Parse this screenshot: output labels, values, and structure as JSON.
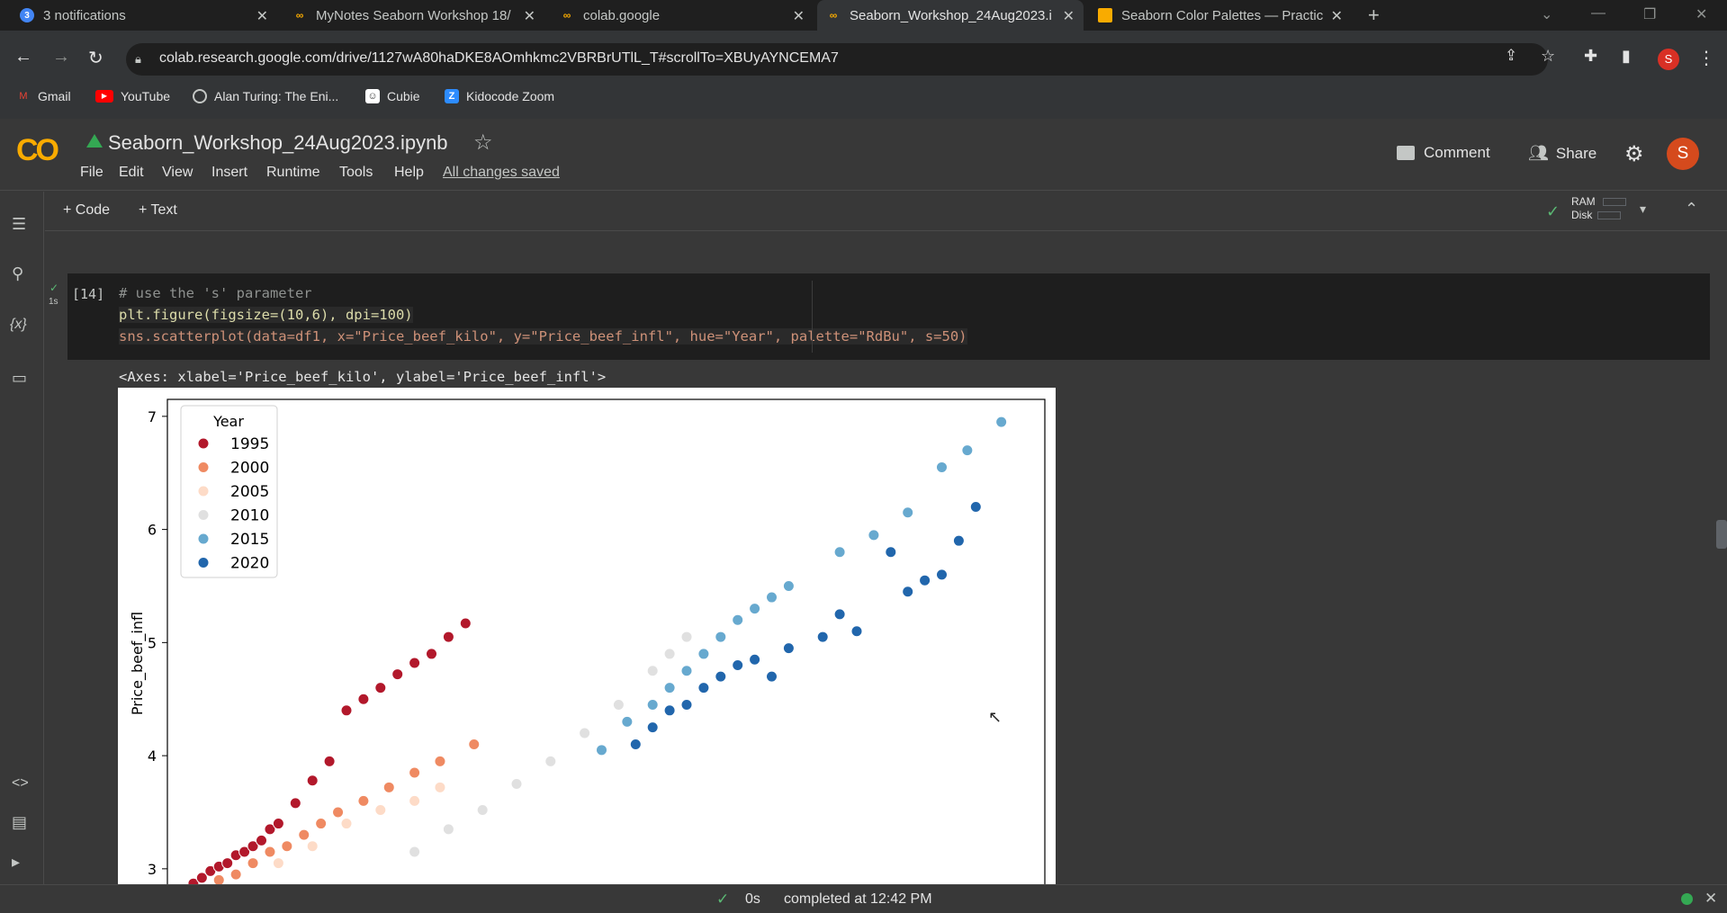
{
  "browser": {
    "tabs": [
      {
        "title": "3 notifications",
        "badge": "3"
      },
      {
        "title": "MyNotes Seaborn Workshop 18/"
      },
      {
        "title": "colab.google"
      },
      {
        "title": "Seaborn_Workshop_24Aug2023.i"
      },
      {
        "title": "Seaborn Color Palettes — Practic"
      }
    ],
    "new_tab": "+",
    "url": "colab.research.google.com/drive/1127wA80haDKE8AOmhkmc2VBRBrUTlL_T#scrollTo=XBUyAYNCEMA7",
    "profile_initial": "S",
    "bookmarks": [
      {
        "label": "Gmail"
      },
      {
        "label": "YouTube"
      },
      {
        "label": "Alan Turing: The Eni..."
      },
      {
        "label": "Cubie"
      },
      {
        "label": "Kidocode Zoom"
      }
    ]
  },
  "colab": {
    "logo": "CO",
    "notebook_title": "Seaborn_Workshop_24Aug2023.ipynb",
    "menu": [
      "File",
      "Edit",
      "View",
      "Insert",
      "Runtime",
      "Tools",
      "Help"
    ],
    "save_status": "All changes saved",
    "comment_label": "Comment",
    "share_label": "Share",
    "avatar_initial": "S",
    "add_code": "+ Code",
    "add_text": "+ Text",
    "ram_label": "RAM",
    "disk_label": "Disk"
  },
  "cell": {
    "exec_count": "[14]",
    "exec_time": "1s",
    "line1": "# use the 's' parameter",
    "line2": "plt.figure(figsize=(10,6), dpi=100)",
    "line3": "sns.scatterplot(data=df1, x=\"Price_beef_kilo\", y=\"Price_beef_infl\", hue=\"Year\", palette=\"RdBu\", s=50)",
    "output_text": "<Axes: xlabel='Price_beef_kilo', ylabel='Price_beef_infl'>"
  },
  "chart_data": {
    "type": "scatter",
    "ylabel": "Price_beef_infl",
    "xlabel": "",
    "yticks": [
      3,
      4,
      5,
      6,
      7
    ],
    "ylim": [
      2.8,
      7.15
    ],
    "xlim": [
      0,
      1
    ],
    "legend_title": "Year",
    "legend_position": "top-left",
    "series": [
      {
        "name": "1995",
        "color": "#b2182b",
        "points": [
          [
            0.02,
            2.87
          ],
          [
            0.03,
            2.92
          ],
          [
            0.04,
            2.98
          ],
          [
            0.05,
            3.02
          ],
          [
            0.06,
            3.05
          ],
          [
            0.07,
            3.12
          ],
          [
            0.08,
            3.15
          ],
          [
            0.09,
            3.2
          ],
          [
            0.1,
            3.25
          ],
          [
            0.11,
            3.35
          ],
          [
            0.12,
            3.4
          ],
          [
            0.14,
            3.58
          ],
          [
            0.16,
            3.78
          ],
          [
            0.18,
            3.95
          ],
          [
            0.2,
            4.4
          ],
          [
            0.22,
            4.5
          ],
          [
            0.24,
            4.6
          ],
          [
            0.26,
            4.72
          ],
          [
            0.28,
            4.82
          ],
          [
            0.3,
            4.9
          ],
          [
            0.32,
            5.05
          ],
          [
            0.34,
            5.17
          ]
        ]
      },
      {
        "name": "2000",
        "color": "#ef8a62",
        "points": [
          [
            0.05,
            2.9
          ],
          [
            0.07,
            2.95
          ],
          [
            0.09,
            3.05
          ],
          [
            0.11,
            3.15
          ],
          [
            0.13,
            3.2
          ],
          [
            0.15,
            3.3
          ],
          [
            0.17,
            3.4
          ],
          [
            0.19,
            3.5
          ],
          [
            0.22,
            3.6
          ],
          [
            0.25,
            3.72
          ],
          [
            0.28,
            3.85
          ],
          [
            0.31,
            3.95
          ],
          [
            0.35,
            4.1
          ]
        ]
      },
      {
        "name": "2005",
        "color": "#fddbc7",
        "points": [
          [
            0.12,
            3.05
          ],
          [
            0.16,
            3.2
          ],
          [
            0.2,
            3.4
          ],
          [
            0.24,
            3.52
          ],
          [
            0.28,
            3.6
          ],
          [
            0.31,
            3.72
          ]
        ]
      },
      {
        "name": "2010",
        "color": "#e0e0e0",
        "points": [
          [
            0.28,
            3.15
          ],
          [
            0.32,
            3.35
          ],
          [
            0.36,
            3.52
          ],
          [
            0.4,
            3.75
          ],
          [
            0.44,
            3.95
          ],
          [
            0.48,
            4.2
          ],
          [
            0.52,
            4.45
          ],
          [
            0.56,
            4.75
          ],
          [
            0.58,
            4.9
          ],
          [
            0.6,
            5.05
          ]
        ]
      },
      {
        "name": "2015",
        "color": "#67a9cf",
        "points": [
          [
            0.5,
            4.05
          ],
          [
            0.53,
            4.3
          ],
          [
            0.56,
            4.45
          ],
          [
            0.58,
            4.6
          ],
          [
            0.6,
            4.75
          ],
          [
            0.62,
            4.9
          ],
          [
            0.64,
            5.05
          ],
          [
            0.66,
            5.2
          ],
          [
            0.68,
            5.3
          ],
          [
            0.7,
            5.4
          ],
          [
            0.72,
            5.5
          ],
          [
            0.78,
            5.8
          ],
          [
            0.82,
            5.95
          ],
          [
            0.86,
            6.15
          ],
          [
            0.9,
            6.55
          ],
          [
            0.93,
            6.7
          ],
          [
            0.97,
            6.95
          ]
        ]
      },
      {
        "name": "2020",
        "color": "#2166ac",
        "points": [
          [
            0.54,
            4.1
          ],
          [
            0.56,
            4.25
          ],
          [
            0.58,
            4.4
          ],
          [
            0.6,
            4.45
          ],
          [
            0.62,
            4.6
          ],
          [
            0.64,
            4.7
          ],
          [
            0.66,
            4.8
          ],
          [
            0.68,
            4.85
          ],
          [
            0.7,
            4.7
          ],
          [
            0.72,
            4.95
          ],
          [
            0.76,
            5.05
          ],
          [
            0.78,
            5.25
          ],
          [
            0.8,
            5.1
          ],
          [
            0.84,
            5.8
          ],
          [
            0.86,
            5.45
          ],
          [
            0.88,
            5.55
          ],
          [
            0.9,
            5.6
          ],
          [
            0.92,
            5.9
          ],
          [
            0.94,
            6.2
          ]
        ]
      }
    ]
  },
  "status": {
    "elapsed": "0s",
    "message": "completed at 12:42 PM"
  }
}
